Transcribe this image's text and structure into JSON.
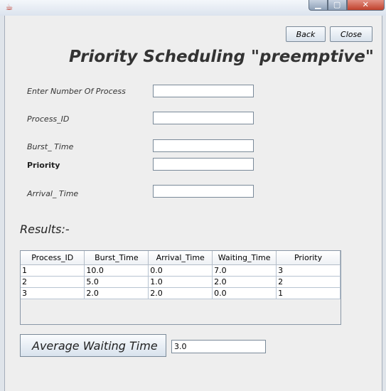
{
  "window": {
    "icon": "java-icon",
    "controls": {
      "minimize": "▁",
      "maximize": "▢",
      "close": "✕"
    }
  },
  "toolbar": {
    "back_label": "Back",
    "close_label": "Close"
  },
  "page_title": "Priority Scheduling \"preemptive\"",
  "form": {
    "num_process_label": "Enter Number Of Process",
    "num_process_value": "",
    "process_id_label": "Process_ID",
    "process_id_value": "",
    "burst_time_label": "Burst_ Time",
    "burst_time_value": "",
    "priority_label": "Priority",
    "priority_value": "",
    "arrival_time_label": "Arrival_ Time",
    "arrival_time_value": ""
  },
  "results_label": "Results:-",
  "table": {
    "headers": [
      "Process_ID",
      "Burst_Time",
      "Arrival_Time",
      "Waiting_Time",
      "Priority"
    ],
    "rows": [
      [
        "1",
        "10.0",
        "0.0",
        "7.0",
        "3"
      ],
      [
        "2",
        "5.0",
        "1.0",
        "2.0",
        "2"
      ],
      [
        "3",
        "2.0",
        "2.0",
        "0.0",
        "1"
      ]
    ]
  },
  "average": {
    "button_label": "Average Waiting Time",
    "value": "3.0"
  },
  "colors": {
    "background": "#eeeeee",
    "title": "#333333",
    "close_button": "#c0412c"
  }
}
